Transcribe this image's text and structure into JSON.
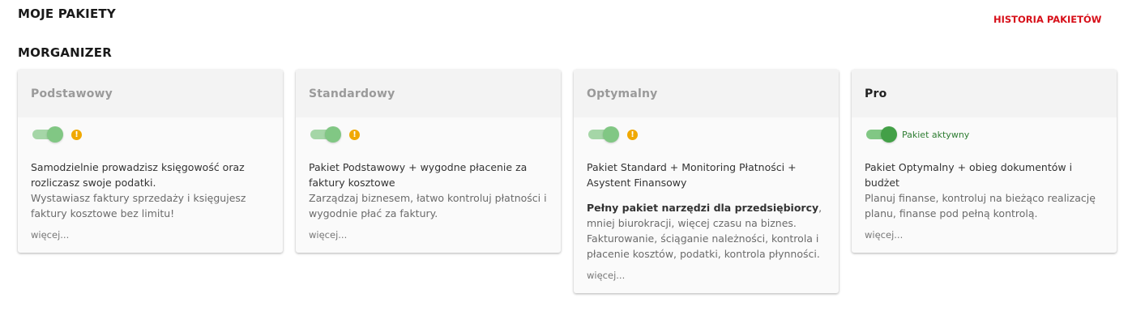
{
  "header": {
    "title": "MOJE PAKIETY",
    "history_link": "HISTORIA PAKIETÓW"
  },
  "section": {
    "title": "MORGANIZER"
  },
  "colors": {
    "accent_red": "#d7101a",
    "toggle_green": "#43a047",
    "warning_orange": "#f0a800"
  },
  "cards": [
    {
      "name": "Podstawowy",
      "toggle_on": true,
      "warning_icon": "!",
      "description_main": "Samodzielnie prowadzisz księgowość oraz rozliczasz swoje podatki.",
      "description_sub": "Wystawiasz faktury sprzedaży i księgujesz faktury kosztowe bez limitu!",
      "more": "więcej..."
    },
    {
      "name": "Standardowy",
      "toggle_on": true,
      "warning_icon": "!",
      "description_main": "Pakiet Podstawowy + wygodne płacenie za faktury kosztowe",
      "description_sub": "Zarządzaj biznesem, łatwo kontroluj płatności i wygodnie płać za faktury.",
      "more": "więcej..."
    },
    {
      "name": "Optymalny",
      "toggle_on": true,
      "warning_icon": "!",
      "description_main": "Pakiet Standard + Monitoring Płatności + Asystent Finansowy",
      "description_bold": "Pełny pakiet narzędzi dla przedsiębiorcy",
      "description_sub": ", mniej biurokracji, więcej czasu na biznes. Fakturowanie, ściąganie należności, kontrola i płacenie kosztów, podatki, kontrola płynności.",
      "more": "więcej..."
    },
    {
      "name": "Pro",
      "toggle_on": true,
      "status": "Pakiet aktywny",
      "description_main": "Pakiet Optymalny + obieg dokumentów i budżet",
      "description_sub": "Planuj finanse, kontroluj na bieżąco realizację planu, finanse pod pełną kontrolą.",
      "more": "więcej..."
    }
  ]
}
